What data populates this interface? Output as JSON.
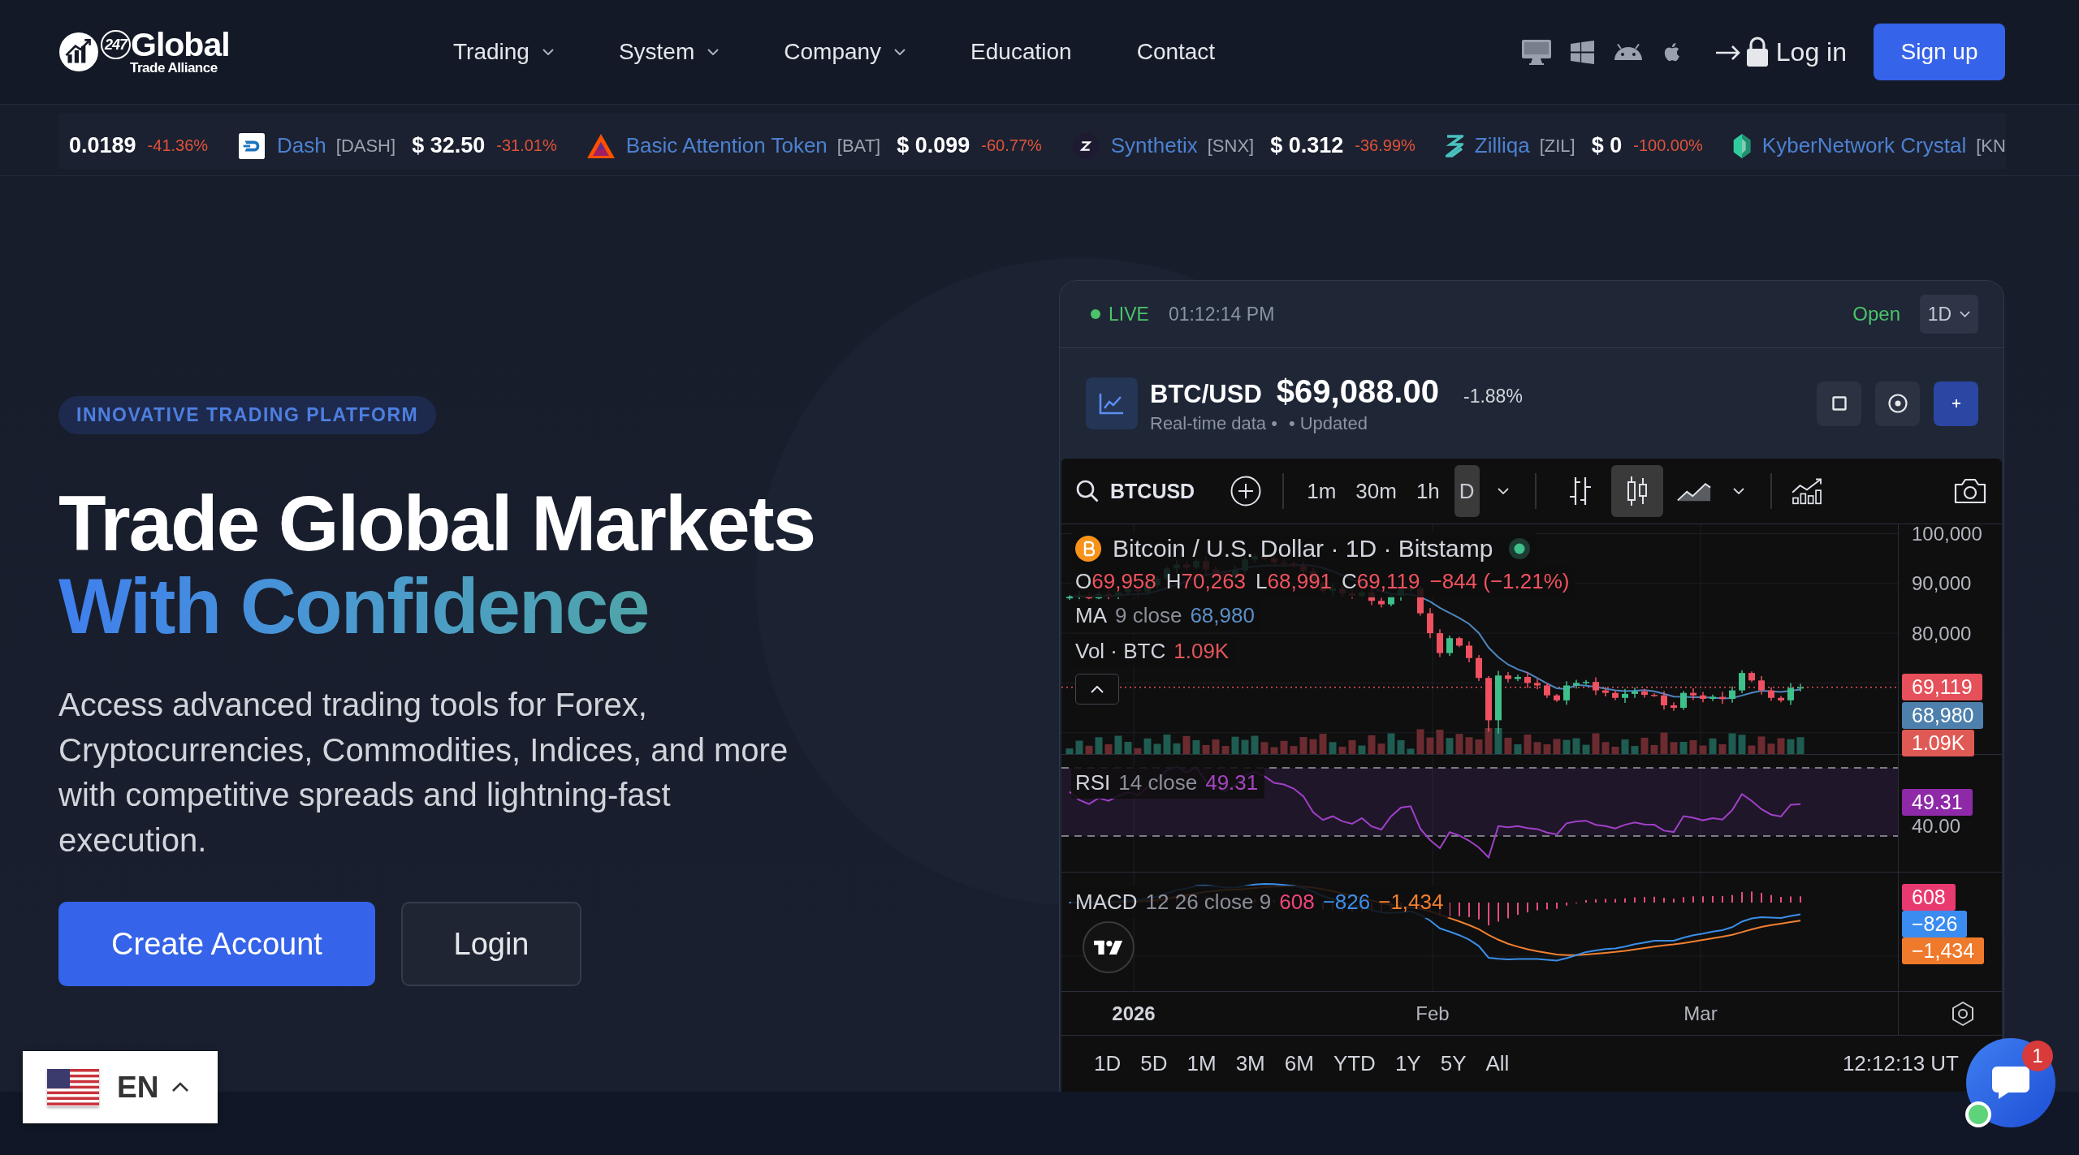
{
  "header": {
    "logo": {
      "badge": "247",
      "name": "Global",
      "tagline": "Trade Alliance"
    },
    "nav": [
      {
        "label": "Trading",
        "dropdown": true
      },
      {
        "label": "System",
        "dropdown": true
      },
      {
        "label": "Company",
        "dropdown": true
      },
      {
        "label": "Education",
        "dropdown": false
      },
      {
        "label": "Contact",
        "dropdown": false
      }
    ],
    "platforms": [
      {
        "kind": "desktop"
      },
      {
        "kind": "windows"
      },
      {
        "kind": "android"
      },
      {
        "kind": "apple"
      }
    ],
    "login": "Log in",
    "signup": "Sign up"
  },
  "ticker": [
    {
      "price": "0.0189",
      "change": "-41.36%"
    },
    {
      "kind": "tile",
      "name": "Dash",
      "symbol": "[DASH]",
      "price": "$ 32.50",
      "change": "-31.01%"
    },
    {
      "kind": "triangle",
      "name": "Basic Attention Token",
      "symbol": "[BAT]",
      "price": "$ 0.099",
      "change": "-60.77%"
    },
    {
      "kind": "disc",
      "name": "Synthetix",
      "symbol": "[SNX]",
      "price": "$ 0.312",
      "change": "-36.99%"
    },
    {
      "kind": "zigzag",
      "name": "Zilliqa",
      "symbol": "[ZIL]",
      "price": "$ 0",
      "change": "-100.00%"
    },
    {
      "kind": "gem",
      "name": "KyberNetwork Crystal",
      "symbol": "[KN"
    }
  ],
  "hero": {
    "eyebrow": "INNOVATIVE TRADING PLATFORM",
    "title": "Trade Global Markets",
    "title_accent": "With Confidence",
    "description": "Access advanced trading tools for Forex, Cryptocurrencies, Commodities, Indices, and more with competitive spreads and lightning-fast execution.",
    "buttons": [
      {
        "label": "Create Account",
        "kind": "primary"
      },
      {
        "label": "Login",
        "kind": "secondary"
      }
    ]
  },
  "widget": {
    "status": {
      "live": true,
      "label": "LIVE",
      "time": "01:12:14 PM",
      "market": "Open",
      "interval": "1D"
    },
    "quote": {
      "pair": "BTC/USD",
      "price": "$69,088.00",
      "change": "-1.88%",
      "note": "Real-time data •",
      "updated": "• Updated"
    },
    "actions": [
      {
        "kind": "square"
      },
      {
        "kind": "target"
      },
      {
        "kind": "add"
      }
    ],
    "chart": {
      "symbol": "BTCUSD",
      "intervals": [
        {
          "label": "1m",
          "selected": false
        },
        {
          "label": "30m",
          "selected": false
        },
        {
          "label": "1h",
          "selected": false
        },
        {
          "label": "D",
          "selected": true
        }
      ],
      "styles": [
        {
          "kind": "bars",
          "selected": false
        },
        {
          "kind": "candles",
          "selected": true
        },
        {
          "kind": "area",
          "selected": false
        }
      ],
      "title": "Bitcoin / U.S. Dollar · 1D · Bitstamp",
      "market_open": true,
      "ohlc": [
        {
          "key": "O",
          "value": "69,958"
        },
        {
          "key": "H",
          "value": "70,263"
        },
        {
          "key": "L",
          "value": "68,991"
        },
        {
          "key": "C",
          "value": "69,119"
        }
      ],
      "change": "−844 (−1.21%)",
      "panes": [
        {
          "kind": "price",
          "legends": [
            {
              "name": "MA",
              "params": "9 close",
              "values": [
                {
                  "text": "68,980",
                  "color": "#5b8fc7"
                }
              ]
            },
            {
              "name": "Vol · BTC",
              "values": [
                {
                  "text": "1.09K",
                  "color": "#e0555a"
                }
              ]
            }
          ],
          "ticks": [
            "100,000",
            "90,000",
            "80,000"
          ],
          "tags": [
            {
              "label": "69,119",
              "color": "#e5505a"
            },
            {
              "label": "68,980",
              "color": "#4e80ad"
            },
            {
              "label": "1.09K",
              "color": "#e05a55"
            }
          ]
        },
        {
          "kind": "rsi",
          "legends": [
            {
              "name": "RSI",
              "params": "14 close",
              "values": [
                {
                  "text": "49.31",
                  "color": "#a545c2"
                }
              ]
            }
          ],
          "ticks": [
            "40.00"
          ],
          "tags": [
            {
              "label": "49.31",
              "color": "#8e2aa8"
            }
          ]
        },
        {
          "kind": "macd",
          "legends": [
            {
              "name": "MACD",
              "params": "12 26 close 9",
              "values": [
                {
                  "text": "608",
                  "color": "#f0457a"
                },
                {
                  "text": "−826",
                  "color": "#3b8ee8"
                },
                {
                  "text": "−1,434",
                  "color": "#f08030"
                }
              ]
            }
          ],
          "tags": [
            {
              "label": "608",
              "color": "#e83a6e"
            },
            {
              "label": "−826",
              "color": "#3a8cf0"
            },
            {
              "label": "−1,434",
              "color": "#ef7a2c"
            }
          ]
        }
      ],
      "time_labels": [
        {
          "text": "2026",
          "kind": "year"
        },
        {
          "text": "Feb",
          "kind": "month"
        },
        {
          "text": "Mar",
          "kind": "month"
        }
      ],
      "ranges": [
        "1D",
        "5D",
        "1M",
        "3M",
        "6M",
        "YTD",
        "1Y",
        "5Y",
        "All"
      ],
      "clock": "12:12:13 UT"
    }
  },
  "language": {
    "code": "EN"
  },
  "chat": {
    "badge": "1",
    "online": true
  }
}
